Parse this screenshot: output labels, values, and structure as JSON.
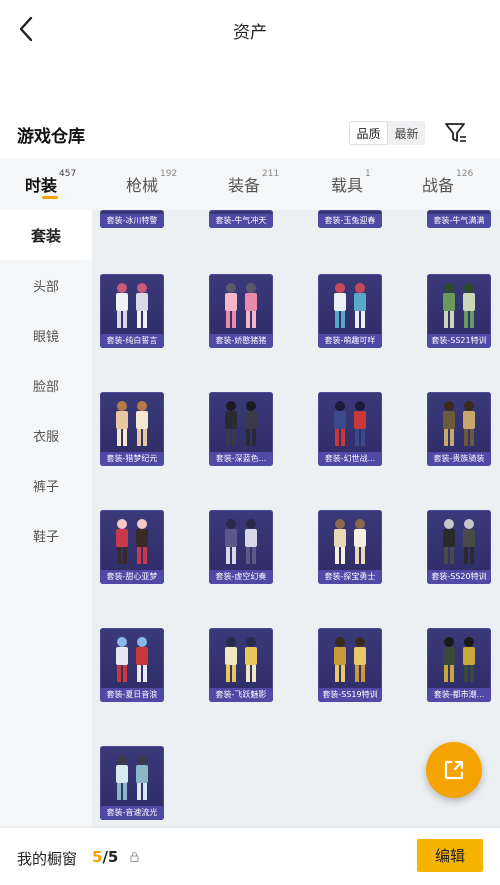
{
  "header": {
    "title": "资产",
    "back_icon": "chevron-left-icon"
  },
  "warehouse": {
    "title": "游戏仓库",
    "sort_options": [
      "品质",
      "最新"
    ],
    "sort_selected": "品质",
    "filter_icon": "filter-icon"
  },
  "tabs": [
    {
      "label": "时装",
      "count": "457",
      "active": true
    },
    {
      "label": "枪械",
      "count": "192",
      "active": false
    },
    {
      "label": "装备",
      "count": "211",
      "active": false
    },
    {
      "label": "载具",
      "count": "1",
      "active": false
    },
    {
      "label": "战备",
      "count": "126",
      "active": false
    }
  ],
  "sidebar": {
    "items": [
      "套装",
      "头部",
      "眼镜",
      "脸部",
      "衣服",
      "裤子",
      "鞋子"
    ],
    "active": "套装"
  },
  "items_partial": [
    "套装-冰川特警",
    "套装-牛气冲天",
    "套装-玉兔迎春",
    "套装-牛气满满"
  ],
  "items": [
    {
      "label": "套装-纯白誓言",
      "palette": [
        "#f0f0f5",
        "#d9d9e8",
        "#c85a7a"
      ]
    },
    {
      "label": "套装-娇憨猪猪",
      "palette": [
        "#f4b6c8",
        "#e88aa8",
        "#5a5a6a"
      ]
    },
    {
      "label": "套装-萌趣可咩",
      "palette": [
        "#e8f0f5",
        "#5aa8c8",
        "#c84a5a"
      ]
    },
    {
      "label": "套装-SS21特训",
      "palette": [
        "#6a9a5a",
        "#c8d8b8",
        "#2a4a2a"
      ]
    },
    {
      "label": "套装-猎梦纪元",
      "palette": [
        "#e8c8a0",
        "#f5e8d0",
        "#b87a4a"
      ]
    },
    {
      "label": "套装-深蓝色...",
      "palette": [
        "#2a2a32",
        "#3a3a48",
        "#1a1a22"
      ]
    },
    {
      "label": "套装-幻世战...",
      "palette": [
        "#3a4a8a",
        "#c83a3a",
        "#1a1a3a"
      ]
    },
    {
      "label": "套装-贵族骑装",
      "palette": [
        "#6a5a3a",
        "#c8a86a",
        "#3a2a1a"
      ]
    },
    {
      "label": "套装-甜心亚梦",
      "palette": [
        "#c83a4a",
        "#3a2a2a",
        "#f5c8c8"
      ]
    },
    {
      "label": "套装-虚空幻奏",
      "palette": [
        "#5a5a8a",
        "#d8d8e8",
        "#2a2a4a"
      ]
    },
    {
      "label": "套装-探宝勇士",
      "palette": [
        "#e8d8b8",
        "#f5f0e0",
        "#8a6a4a"
      ]
    },
    {
      "label": "套装-SS20特训",
      "palette": [
        "#2a2a2a",
        "#4a4a4a",
        "#c8c8c8"
      ]
    },
    {
      "label": "套装-夏日音浪",
      "palette": [
        "#e8e8f0",
        "#c83a3a",
        "#8ab8e8"
      ]
    },
    {
      "label": "套装-飞跃魅影",
      "palette": [
        "#f0e8c0",
        "#e8c85a",
        "#2a2a4a"
      ]
    },
    {
      "label": "套装-SS19特训",
      "palette": [
        "#c89a3a",
        "#e8c86a",
        "#3a2a1a"
      ]
    },
    {
      "label": "套装-都市潮...",
      "palette": [
        "#3a4a3a",
        "#c8a83a",
        "#1a1a1a"
      ]
    },
    {
      "label": "套装-音速流光",
      "palette": [
        "#d8e8f0",
        "#8ab8c8",
        "#3a3a4a"
      ]
    }
  ],
  "fab": {
    "icon": "share-icon"
  },
  "bottom": {
    "label": "我的橱窗",
    "current": "5",
    "total": "/5",
    "lock_icon": "lock-icon",
    "edit_label": "编辑"
  }
}
